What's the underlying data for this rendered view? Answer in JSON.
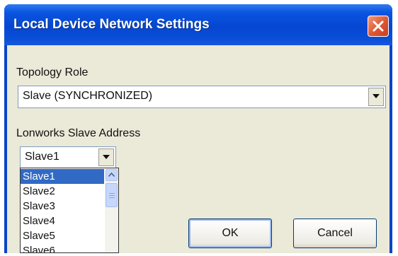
{
  "window": {
    "title": "Local Device Network Settings",
    "close_icon": "close-icon"
  },
  "topology": {
    "label": "Topology Role",
    "value": "Slave (SYNCHRONIZED)"
  },
  "slave_address": {
    "label": "Lonworks Slave Address",
    "value": "Slave1",
    "options": [
      "Slave1",
      "Slave2",
      "Slave3",
      "Slave4",
      "Slave5",
      "Slave6"
    ],
    "selected_index": 0
  },
  "buttons": {
    "ok": "OK",
    "cancel": "Cancel"
  },
  "colors": {
    "title_bar": "#0546d2",
    "dialog_bg": "#ebe9d8",
    "selection": "#316ac5",
    "close_button": "#dd5533"
  }
}
